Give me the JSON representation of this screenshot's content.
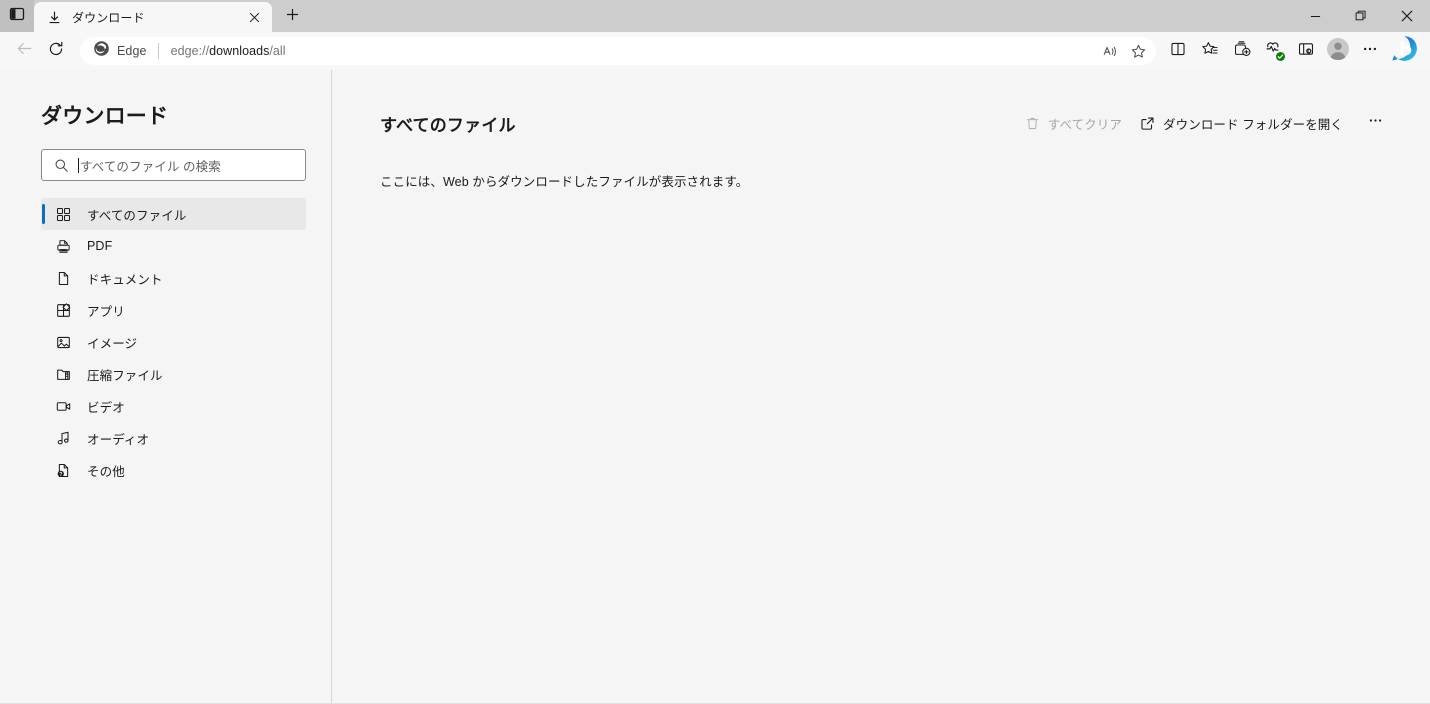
{
  "window": {
    "tabstrip_button": "tab-actions",
    "minimize": "─",
    "maximize": "□",
    "close": "×"
  },
  "tabs": [
    {
      "title": "ダウンロード",
      "icon": "download-icon",
      "close_label": "×"
    }
  ],
  "newtab_label": "+",
  "navigation": {
    "back": "back-arrow-icon",
    "reload": "reload-icon"
  },
  "address": {
    "badge_label": "Edge",
    "url_scheme": "edge://",
    "url_host": "downloads",
    "url_path": "/all",
    "read_aloud": "read-aloud-icon",
    "favorite": "star-icon"
  },
  "toolbar_right": {
    "split_screen": "split-screen-icon",
    "favorites": "favorites-icon",
    "collections": "collections-icon",
    "browser_essentials": "browser-essentials-icon",
    "drop_target": "drop-target-icon",
    "profile": "profile-avatar",
    "settings": "…",
    "copilot": "copilot-logo",
    "copilot_letter": "b"
  },
  "sidebar": {
    "title": "ダウンロード",
    "search": {
      "placeholder": "すべてのファイル の検索",
      "value": "",
      "icon": "search-icon"
    },
    "items": [
      {
        "label": "すべてのファイル",
        "icon": "all-files-icon",
        "selected": true
      },
      {
        "label": "PDF",
        "icon": "pdf-icon",
        "selected": false
      },
      {
        "label": "ドキュメント",
        "icon": "document-icon",
        "selected": false
      },
      {
        "label": "アプリ",
        "icon": "apps-icon",
        "selected": false
      },
      {
        "label": "イメージ",
        "icon": "image-icon",
        "selected": false
      },
      {
        "label": "圧縮ファイル",
        "icon": "archive-icon",
        "selected": false
      },
      {
        "label": "ビデオ",
        "icon": "video-icon",
        "selected": false
      },
      {
        "label": "オーディオ",
        "icon": "audio-icon",
        "selected": false
      },
      {
        "label": "その他",
        "icon": "other-icon",
        "selected": false
      }
    ]
  },
  "main": {
    "title": "すべてのファイル",
    "actions": {
      "clear_all": {
        "label": "すべてクリア",
        "icon": "trash-icon",
        "disabled": true
      },
      "open_folder": {
        "label": "ダウンロード フォルダーを開く",
        "icon": "open-external-icon",
        "disabled": false
      },
      "more": "···"
    },
    "empty_message": "ここには、Web からダウンロードしたファイルが表示されます。"
  },
  "colors": {
    "accent": "#0f6cbd",
    "titlebar_bg": "#cdcdcd",
    "toolbar_bg": "#f7f7f7",
    "page_bg": "#f5f5f5",
    "selected_bg": "#e8e8e8",
    "disabled_text": "#a6a6a6",
    "badge_green": "#0f7b0f"
  }
}
